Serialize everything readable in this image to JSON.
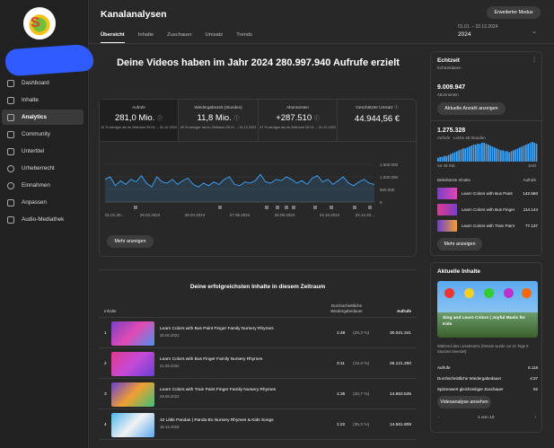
{
  "header": {
    "title": "Kanalanalysen",
    "advanced_button": "Erweiterter Modus",
    "date_range": "01.01. – 22.12.2024",
    "year": "2024"
  },
  "tabs": [
    "Übersicht",
    "Inhalte",
    "Zuschauer",
    "Umsatz",
    "Trends"
  ],
  "sidebar": {
    "items": [
      {
        "label": "Dashboard",
        "icon": "dashboard-icon"
      },
      {
        "label": "Inhalte",
        "icon": "content-icon"
      },
      {
        "label": "Analytics",
        "icon": "analytics-icon"
      },
      {
        "label": "Community",
        "icon": "community-icon"
      },
      {
        "label": "Untertitel",
        "icon": "subtitles-icon"
      },
      {
        "label": "Urheberrecht",
        "icon": "copyright-icon"
      },
      {
        "label": "Einnahmen",
        "icon": "dollar-icon"
      },
      {
        "label": "Anpassen",
        "icon": "customize-icon"
      },
      {
        "label": "Audio-Mediathek",
        "icon": "audio-library-icon"
      }
    ]
  },
  "headline": "Deine Videos haben im Jahr 2024 280.997.940 Aufrufe erzielt",
  "kpis": [
    {
      "label": "Aufrufe",
      "value": "281,0 Mio.",
      "sub": "12 % weniger als im Zeitraum 09.01. – 31.12.2023"
    },
    {
      "label": "Wiedergabezeit (Stunden)",
      "value": "11,8 Mio.",
      "sub": "49 % weniger als im Zeitraum 09.01. – 31.12.2023"
    },
    {
      "label": "Abonnenten",
      "value": "+287.510",
      "sub": "47 % weniger als im Zeitraum 09.01. – 31.12.2023"
    },
    {
      "label": "Geschätzter Umsatz",
      "value": "44.944,56 €",
      "sub": ""
    }
  ],
  "chart_data": {
    "type": "line",
    "x": [
      "01.01.20...",
      "29.02.2024",
      "29.04.2024",
      "27.06.2024",
      "25.08.2024",
      "24.10.2024",
      "22.12.20..."
    ],
    "y_ticks": [
      "1.500.000",
      "1.000.000",
      "500.000",
      "0"
    ],
    "ylim": [
      0,
      1500000
    ],
    "series": [
      {
        "values": [
          900000,
          1000000,
          650000,
          850000,
          700000,
          900000,
          800000,
          1050000,
          750000,
          600000,
          1000000,
          800000,
          750000,
          900000,
          700000,
          850000,
          950000,
          700000,
          600000,
          750000,
          650000,
          800000,
          700000,
          900000,
          1000000,
          700000,
          650000,
          800000,
          750000,
          850000,
          1100000,
          800000,
          750000,
          900000,
          850000,
          1000000,
          900000,
          750000,
          850000,
          700000,
          950000,
          1050000,
          800000,
          900000,
          700000,
          850000,
          1000000,
          750000,
          650000,
          800000,
          900000,
          750000,
          700000
        ]
      }
    ]
  },
  "show_more": "Mehr anzeigen",
  "realtime": {
    "title": "Echtzeit",
    "subtitle": "Echtzeitdaten",
    "subscribers": "9.009.947",
    "subscribers_label": "Abonnenten",
    "actual_button": "Aktuelle Anzahl anzeigen",
    "views": "1.275.328",
    "views_label": "Aufrufe · Letzte 48 Stunden",
    "from": "vor 48 Std.",
    "to": "Jetzt",
    "popular_label": "Beliebteste Inhalte",
    "popular_right": "Aufrufe",
    "popular": [
      {
        "title": "Learn Colors with Bus Paint",
        "views": "142.560"
      },
      {
        "title": "Learn Colors with Bus Finger",
        "views": "114.144"
      },
      {
        "title": "Learn Colors with Train Paint",
        "views": "77.137"
      }
    ],
    "more": "Mehr anzeigen",
    "bars": [
      4,
      5,
      5,
      6,
      6,
      7,
      8,
      9,
      10,
      11,
      12,
      13,
      14,
      14,
      15,
      16,
      17,
      18,
      18,
      19,
      19,
      20,
      20,
      19,
      18,
      17,
      16,
      15,
      14,
      13,
      12,
      12,
      11,
      11,
      10,
      11,
      12,
      13,
      14,
      15,
      16,
      17,
      18,
      19,
      20,
      21,
      20,
      19
    ]
  },
  "current": {
    "title": "Aktuelle Inhalte",
    "video_title": "Sing and Learn Colors | Joyful Music for Kids",
    "note": "Während des Livestreams (Stream wurde vor 21 Tage 9 Stunden beendet)",
    "stats": [
      {
        "label": "Aufrufe",
        "value": "6.118"
      },
      {
        "label": "Durchschnittliche Wiedergabedauer",
        "value": "4:37"
      },
      {
        "label": "Spitzenwert gleichzeitiger Zuschauer",
        "value": "92"
      }
    ],
    "button": "Videoanalyse ansehen",
    "pager": "1 von 10"
  },
  "top": {
    "title": "Deine erfolgreichsten Inhalte in diesem Zeitraum",
    "col_content": "Inhalte",
    "col_avg": "Durchschnittliche Wiedergabedauer",
    "col_views": "Aufrufe",
    "rows": [
      {
        "rank": "1",
        "title": "Learn Colors with Bus Paint Finger Family Nursery Rhymes",
        "date": "25.06.2022",
        "avd": "1:48",
        "pct": "(29,3 %)",
        "views": "30.021.341"
      },
      {
        "rank": "2",
        "title": "Learn Colors with Bus Finger Family Nursery Rhymes",
        "date": "21.09.2022",
        "avd": "3:11",
        "pct": "(19,3 %)",
        "views": "26.121.290"
      },
      {
        "rank": "3",
        "title": "Learn Colors with Train Paint Finger Family Nursery Rhymes",
        "date": "28.06.2022",
        "avd": "1:35",
        "pct": "(30,7 %)",
        "views": "14.853.535"
      },
      {
        "rank": "4",
        "title": "10 Little Pandas | Panda Bo Nursery Rhymes & Kids Songs",
        "date": "16.12.2018",
        "avd": "1:22",
        "pct": "(35,3 %)",
        "views": "14.561.808"
      }
    ]
  }
}
